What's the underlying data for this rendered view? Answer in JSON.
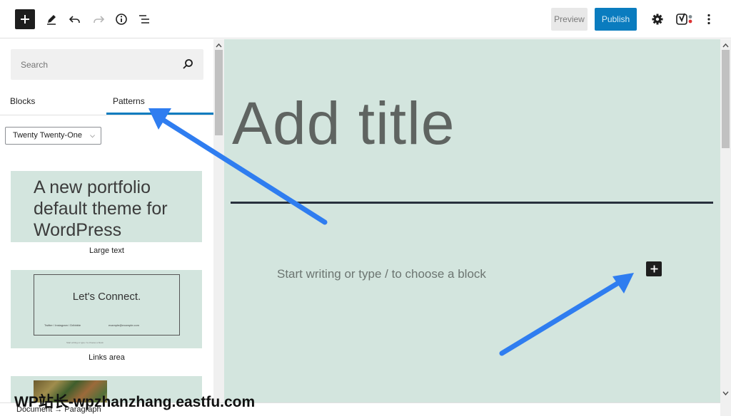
{
  "toolbar": {
    "preview_label": "Preview",
    "publish_label": "Publish"
  },
  "sidebar": {
    "search_placeholder": "Search",
    "tabs": [
      "Blocks",
      "Patterns"
    ],
    "active_tab": "Patterns",
    "category_select": "Twenty Twenty-One",
    "patterns": [
      {
        "label": "Large text",
        "preview_text": [
          "A new portfolio",
          "default theme for",
          "WordPress"
        ]
      },
      {
        "label": "Links area",
        "preview_title": "Let's Connect.",
        "preview_left": "Twitter / Instagram / Dribbble",
        "preview_right": "example@example.com",
        "preview_below": "Start writing or type / to choose a block"
      },
      {
        "label": ""
      }
    ]
  },
  "editor": {
    "title_placeholder": "Add title",
    "body_placeholder": "Start writing or type / to choose a block"
  },
  "footer": {
    "breadcrumb": "Document → Paragraph"
  },
  "watermark": "WP站长-wpzhanzhang.eastfu.com",
  "colors": {
    "canvas_bg": "#d3e5de",
    "publish_bg": "#0a7cbf",
    "annotation_arrow": "#2f7df0"
  }
}
